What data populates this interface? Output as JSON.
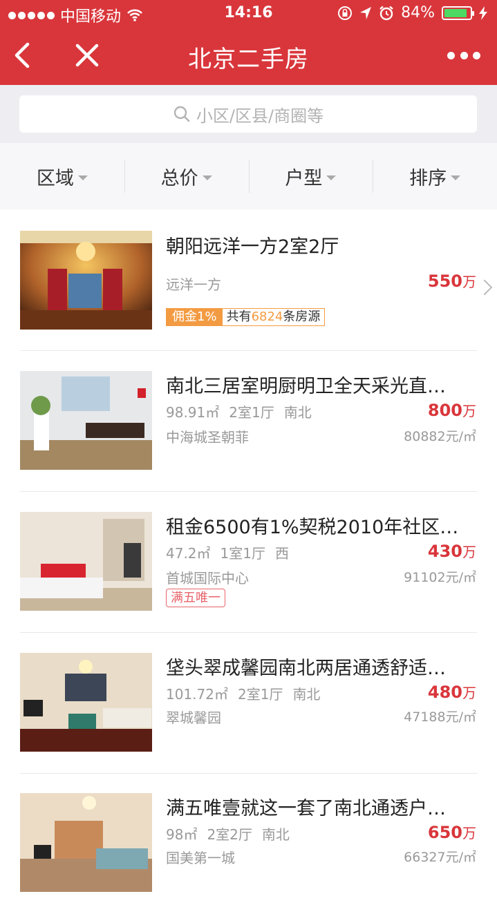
{
  "status": {
    "carrier": "中国移动",
    "time": "14:16",
    "battery": "84%"
  },
  "nav": {
    "title": "北京二手房"
  },
  "search": {
    "placeholder": "小区/区县/商圈等"
  },
  "filters": [
    "区域",
    "总价",
    "户型",
    "排序"
  ],
  "listings": [
    {
      "title": "朝阳远洋一方2室2厅",
      "community": "远洋一方",
      "price": "550",
      "price_unit": "万",
      "commission_label": "佣金1%",
      "sources_prefix": "共有",
      "sources_count": "6824",
      "sources_suffix": "条房源"
    },
    {
      "title": "南北三居室明厨明卫全天采光直…",
      "area": "98.91㎡",
      "layout": "2室1厅",
      "orientation": "南北",
      "community": "中海城圣朝菲",
      "price": "800",
      "price_unit": "万",
      "unit_price": "80882元/㎡"
    },
    {
      "title": "租金6500有1%契税2010年社区…",
      "area": "47.2㎡",
      "layout": "1室1厅",
      "orientation": "西",
      "community": "首城国际中心",
      "price": "430",
      "price_unit": "万",
      "unit_price": "91102元/㎡",
      "tag": "满五唯一"
    },
    {
      "title": "垡头翠成馨园南北两居通透舒适…",
      "area": "101.72㎡",
      "layout": "2室1厅",
      "orientation": "南北",
      "community": "翠城馨园",
      "price": "480",
      "price_unit": "万",
      "unit_price": "47188元/㎡"
    },
    {
      "title": "满五唯壹就这一套了南北通透户…",
      "area": "98㎡",
      "layout": "2室2厅",
      "orientation": "南北",
      "community": "国美第一城",
      "price": "650",
      "price_unit": "万",
      "unit_price": "66327元/㎡"
    }
  ],
  "colors": {
    "brand": "#d9363b",
    "price": "#d9363b",
    "commission": "#f39b42",
    "tag": "#e86268",
    "battery": "#4cd964"
  }
}
